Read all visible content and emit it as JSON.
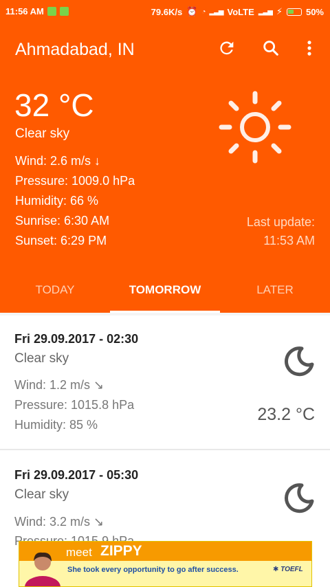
{
  "status_bar": {
    "time": "11:56 AM",
    "speed": "79.6K/s",
    "network": "VoLTE",
    "battery": "50%",
    "battery_level": 0.5
  },
  "app_bar": {
    "title": "Ahmadabad, IN",
    "icons": [
      "refresh-icon",
      "search-icon",
      "more-vert-icon"
    ]
  },
  "current": {
    "temperature": "32 °C",
    "description": "Clear sky",
    "wind": "Wind: 2.6 m/s ↓",
    "pressure": "Pressure: 1009.0 hPa",
    "humidity": "Humidity: 66 %",
    "sunrise": "Sunrise: 6:30 AM",
    "sunset": "Sunset: 6:29 PM",
    "last_update_label": "Last update:",
    "last_update_time": "11:53 AM",
    "icon": "sun-icon"
  },
  "tabs": [
    {
      "label": "TODAY",
      "active": false
    },
    {
      "label": "TOMORROW",
      "active": true
    },
    {
      "label": "LATER",
      "active": false
    }
  ],
  "forecast": [
    {
      "datetime": "Fri 29.09.2017 - 02:30",
      "description": "Clear sky",
      "wind": "Wind: 1.2 m/s ↘",
      "pressure": "Pressure: 1015.8 hPa",
      "humidity": "Humidity: 85 %",
      "temperature": "23.2 °C",
      "icon": "moon-icon"
    },
    {
      "datetime": "Fri 29.09.2017 - 05:30",
      "description": "Clear sky",
      "wind": "Wind: 3.2 m/s ↘",
      "pressure": "Pressure: 1015.9 hPa",
      "icon": "moon-icon"
    }
  ],
  "ad": {
    "meet": "meet",
    "name": "ZIPPY",
    "text": "She took every opportunity to go after success.",
    "logo": "TOEFL"
  },
  "colors": {
    "primary": "#ff5a00",
    "text_secondary": "#777777"
  }
}
